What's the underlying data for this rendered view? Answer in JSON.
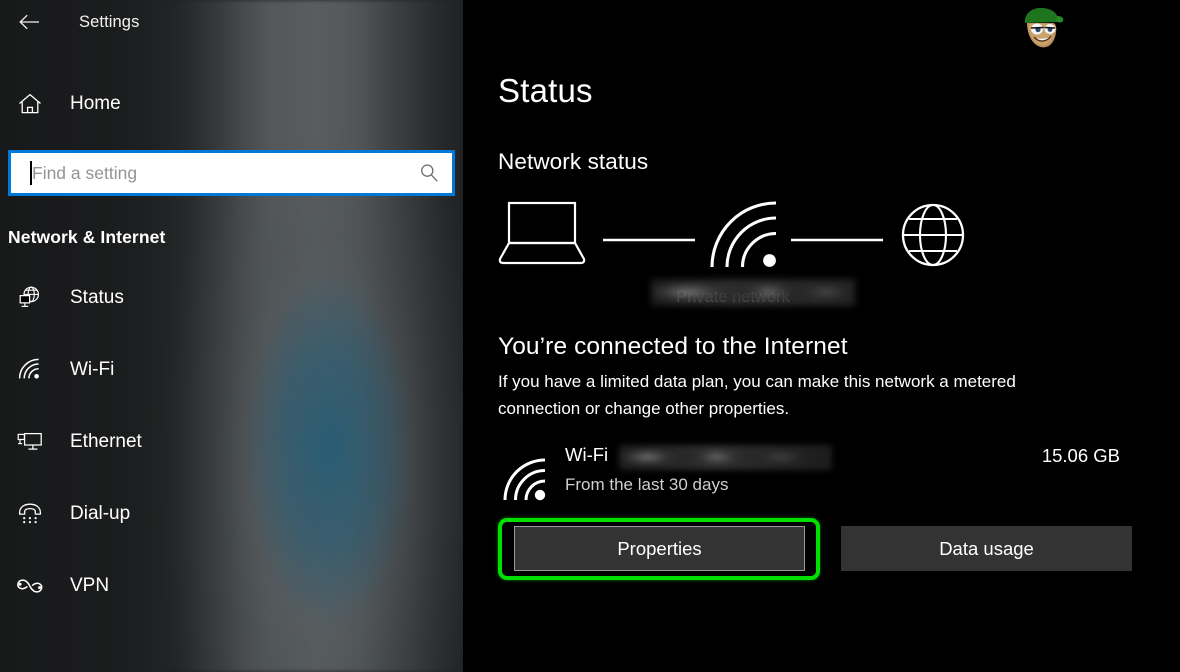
{
  "window": {
    "title": "Settings",
    "back_icon": "back-arrow-icon"
  },
  "sidebar": {
    "home": {
      "label": "Home",
      "icon": "home-icon"
    },
    "search": {
      "value": "",
      "placeholder": "Find a setting",
      "icon": "search-icon"
    },
    "category": "Network & Internet",
    "items": [
      {
        "label": "Status",
        "icon": "globe-monitor-icon"
      },
      {
        "label": "Wi-Fi",
        "icon": "wifi-icon"
      },
      {
        "label": "Ethernet",
        "icon": "ethernet-monitor-icon"
      },
      {
        "label": "Dial-up",
        "icon": "phone-handset-icon"
      },
      {
        "label": "VPN",
        "icon": "vpn-knot-icon"
      }
    ]
  },
  "main": {
    "page_title": "Status",
    "section_title": "Network status",
    "diagram": {
      "device_icon": "laptop-icon",
      "link_icon": "wifi-icon",
      "internet_icon": "globe-icon",
      "ssid": "",
      "network_type": "Private network"
    },
    "connection": {
      "headline": "You’re connected to the Internet",
      "description": "If you have a limited data plan, you can make this network a metered connection or change other properties."
    },
    "usage": {
      "icon": "wifi-icon",
      "name": "Wi-Fi",
      "ssid": "",
      "period": "From the last 30 days",
      "amount": "15.06 GB"
    },
    "buttons": {
      "properties": "Properties",
      "data_usage": "Data usage"
    }
  },
  "watermark": {
    "name": "appuals-mascot-logo"
  },
  "colors": {
    "accent": "#0078d7",
    "highlight": "#00e000",
    "button_bg": "#333333",
    "main_bg": "#000000"
  }
}
